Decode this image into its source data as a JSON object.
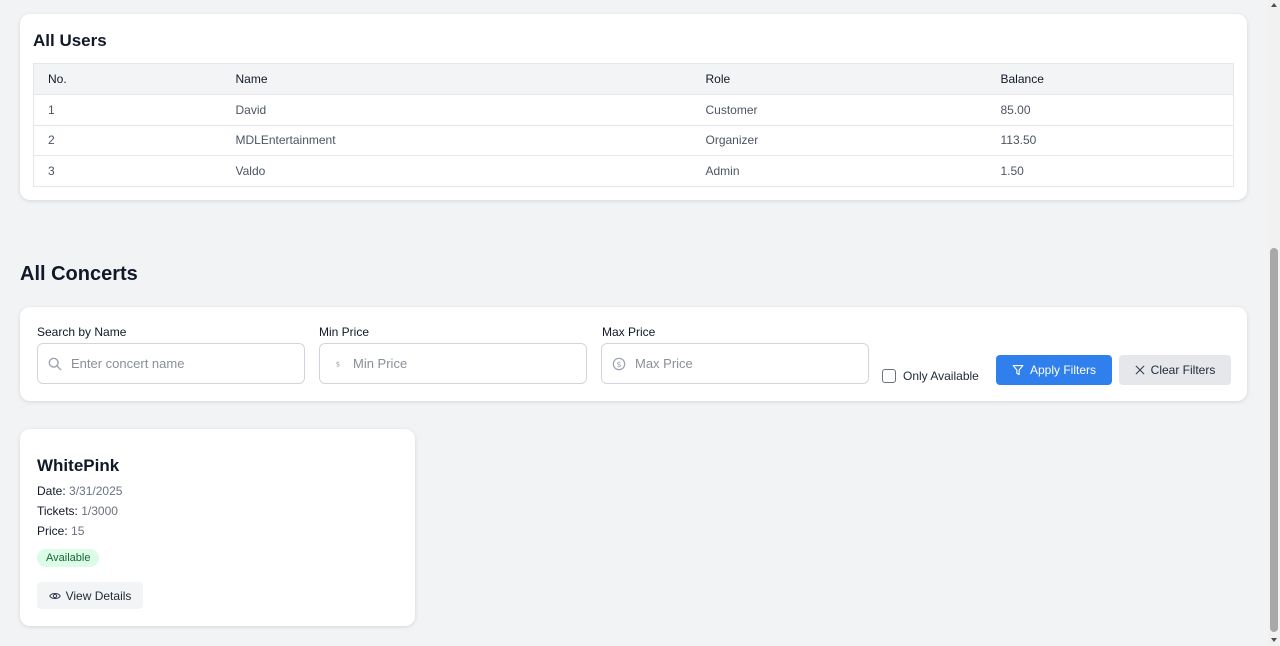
{
  "users": {
    "title": "All Users",
    "columns": [
      "No.",
      "Name",
      "Role",
      "Balance"
    ],
    "rows": [
      {
        "no": "1",
        "name": "David",
        "role": "Customer",
        "balance": "85.00"
      },
      {
        "no": "2",
        "name": "MDLEntertainment",
        "role": "Organizer",
        "balance": "113.50"
      },
      {
        "no": "3",
        "name": "Valdo",
        "role": "Admin",
        "balance": "1.50"
      }
    ]
  },
  "concerts": {
    "title": "All Concerts",
    "filters": {
      "search_label": "Search by Name",
      "search_placeholder": "Enter concert name",
      "min_label": "Min Price",
      "min_placeholder": "Min Price",
      "max_label": "Max Price",
      "max_placeholder": "Max Price",
      "only_available_label": "Only Available",
      "only_available_checked": false,
      "apply_label": "Apply Filters",
      "clear_label": "Clear Filters"
    },
    "items": [
      {
        "name": "WhitePink",
        "date_label": "Date:",
        "date": "3/31/2025",
        "tickets_label": "Tickets:",
        "tickets": "1/3000",
        "price_label": "Price:",
        "price": "15",
        "status": "Available",
        "view_label": "View Details"
      }
    ]
  },
  "icons": {
    "search": "search-icon",
    "min_price": "dollar-icon",
    "max_price": "dollar-circle-icon",
    "apply": "filter-icon",
    "clear": "close-icon",
    "view": "eye-icon"
  },
  "colors": {
    "primary": "#2f80ed",
    "badge_bg": "#dcfce7",
    "badge_text": "#166534"
  }
}
